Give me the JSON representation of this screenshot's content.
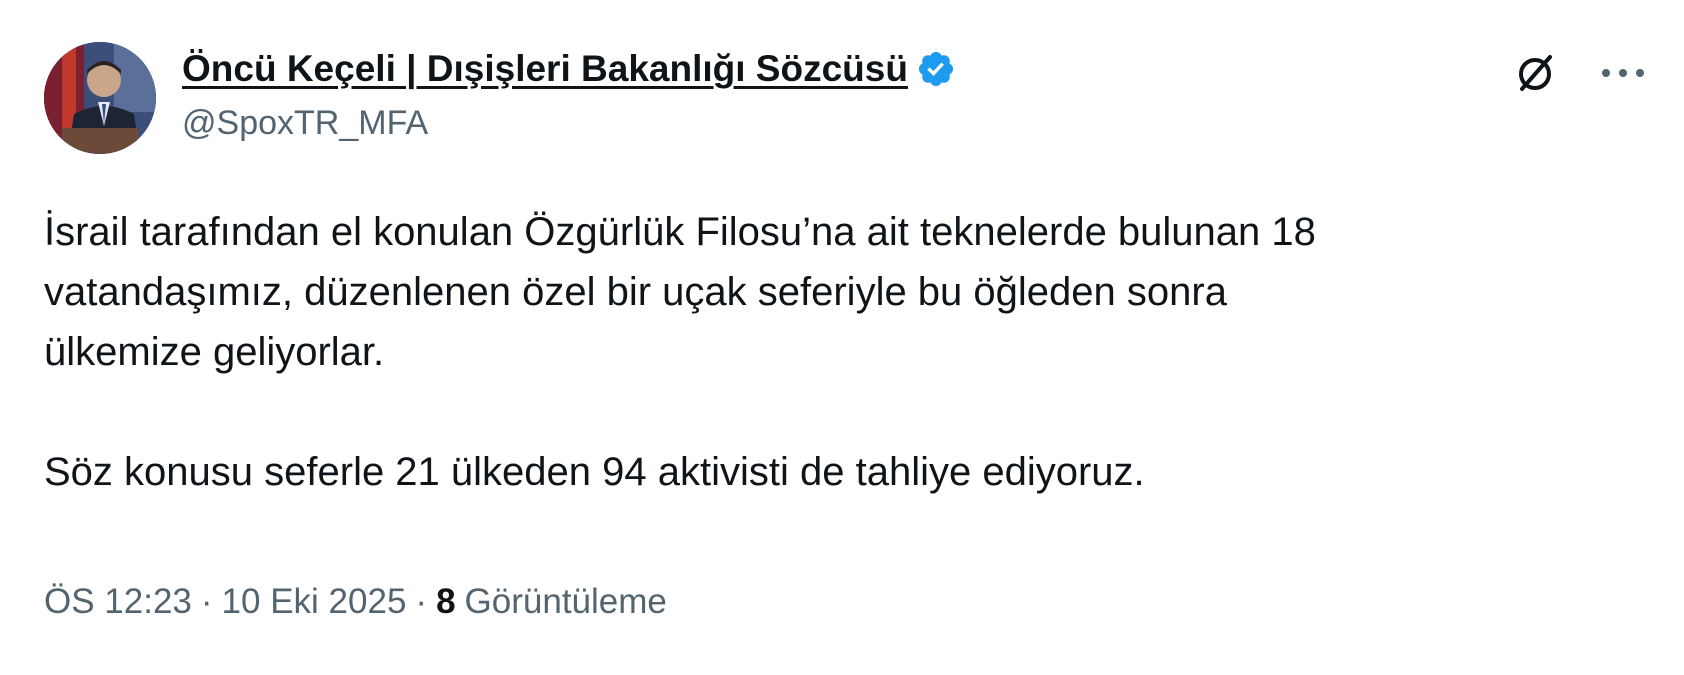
{
  "author": {
    "display_name": "Öncü Keçeli | Dışişleri Bakanlığı Sözcüsü",
    "handle": "@SpoxTR_MFA",
    "verified": true,
    "verified_color": "#1d9bf0"
  },
  "actions": {
    "grok_icon": "grok-slash-circle-icon",
    "more_icon": "more-horizontal-icon"
  },
  "tweet": {
    "paragraph_1": "İsrail tarafından el konulan Özgürlük Filosu’na ait teknelerde bulunan 18\nvatandaşımız, düzenlenen özel bir uçak seferiyle bu öğleden sonra\nülkemize geliyorlar.",
    "paragraph_2": "Söz konusu seferle 21 ülkeden 94 aktivisti de tahliye ediyoruz."
  },
  "meta": {
    "time": "ÖS 12:23",
    "separator": "·",
    "date": "10 Eki 2025",
    "views_count": "8",
    "views_label": "Görüntüleme"
  },
  "colors": {
    "text_primary": "#0f1419",
    "text_secondary": "#536471",
    "accent": "#1d9bf0"
  }
}
